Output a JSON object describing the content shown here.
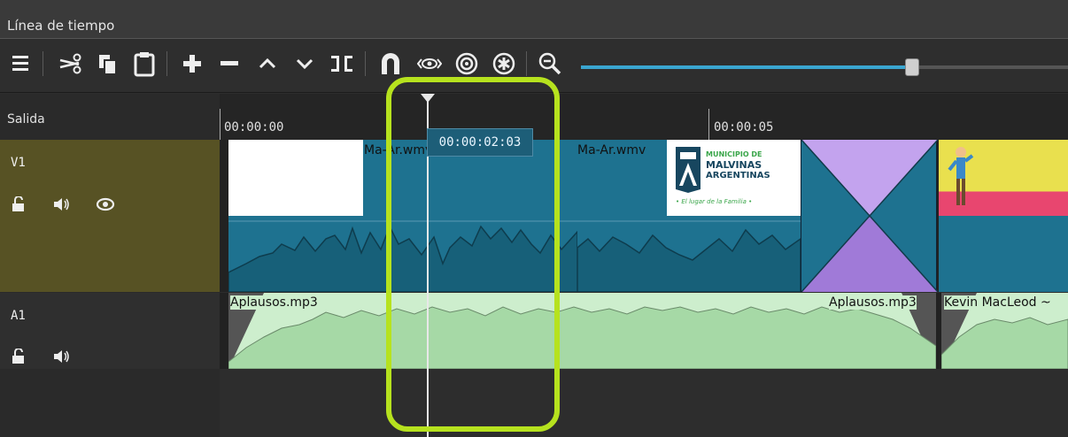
{
  "window": {
    "title": "Línea de tiempo"
  },
  "toolbar": {
    "icons": [
      "menu-icon",
      "cut-icon",
      "copy-icon",
      "paste-icon",
      "add-icon",
      "remove-icon",
      "lift-icon",
      "overwrite-icon",
      "split-icon",
      "snap-icon",
      "scrub-icon",
      "ripple-icon",
      "ripple-all-icon",
      "zoom-out-icon"
    ],
    "zoom_slider_value": 0.68
  },
  "output_track": {
    "label": "Salida"
  },
  "ruler": {
    "ticks": [
      "00:00:00",
      "00:00:05"
    ]
  },
  "playhead": {
    "time": "00:00:02:03"
  },
  "tracks": {
    "v1": {
      "label": "V1"
    },
    "a1": {
      "label": "A1"
    }
  },
  "clips": {
    "video": [
      {
        "name": "Ma-Ar.wmv"
      },
      {
        "name": "Ma-Ar.wmv"
      }
    ],
    "logo": {
      "line1": "MUNICIPIO DE",
      "line2": "MALVINAS",
      "line3": "ARGENTINAS",
      "tagline": "• El lugar de la Familia •"
    },
    "audio": [
      {
        "name": "Aplausos.mp3"
      },
      {
        "name": "Aplausos.mp3"
      },
      {
        "name": "Kevin MacLeod ~"
      }
    ]
  },
  "colors": {
    "video_clip": "#1e7290",
    "audio_clip": "#cdeecd",
    "video_header": "#575224",
    "highlight": "#b6e21e",
    "transition": "#b08be8"
  }
}
